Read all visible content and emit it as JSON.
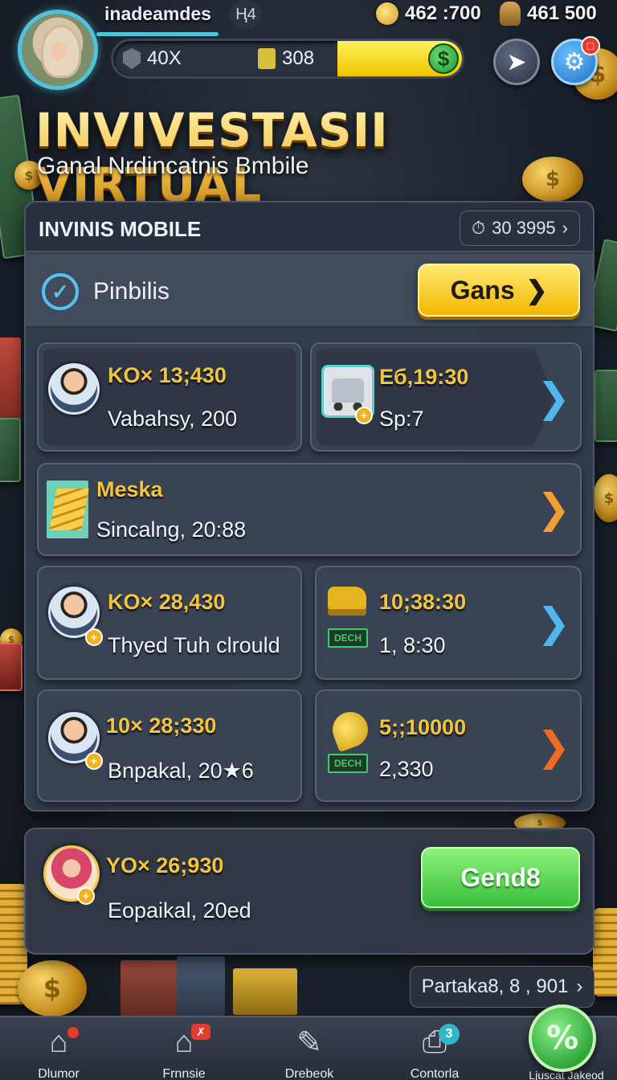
{
  "header": {
    "username": "inadeamdes",
    "level": "Ң4",
    "coins": "462 :700",
    "gems": "461 500",
    "shield_value": "40X",
    "gold_value": "308"
  },
  "title": "INVIVESTASII VIRTUAL",
  "subtitle": "Ganal  Nrdincatnis Bmbile",
  "panel": {
    "title": "INVINIS MOBILE",
    "timer": "30 3995",
    "filter_label": "Pinbilis",
    "filter_button": "Gans"
  },
  "cards": [
    {
      "value": "KO× 13;430",
      "sub": "Vabahsy, 200"
    },
    {
      "value": "Еб,19:30",
      "sub": "Sp:7"
    },
    {
      "value": "Meska",
      "sub": "Sincalng, 20:88"
    },
    {
      "value": "KO× 28,430",
      "sub": "Thyed Tuh clrould"
    },
    {
      "value": "10;38:30",
      "sub": "1, 8:30",
      "tag": "DECH"
    },
    {
      "value": "10× 28;330",
      "sub": "Bnpakal, 20★6"
    },
    {
      "value": "5;;10000",
      "sub": "2,330",
      "tag": "DECH"
    }
  ],
  "bottom_card": {
    "value": "YO× 26;930",
    "sub": "Eopaikal, 20ed",
    "button": "Gend8"
  },
  "partner": "Partaka8, 8 , 901",
  "nav": [
    {
      "label": "Dlumor"
    },
    {
      "label": "Frnnsie"
    },
    {
      "label": "Drebeok"
    },
    {
      "label": "Contorla",
      "badge": "3"
    },
    {
      "label": "Ljuscat Jakeod"
    }
  ],
  "colors": {
    "accent": "#4fc3dc",
    "gold": "#f2c53d",
    "cta_yellow": "#f3b700",
    "cta_green": "#3bbf3a",
    "arrow_blue": "#4db8f0",
    "arrow_orange": "#f0a030"
  }
}
